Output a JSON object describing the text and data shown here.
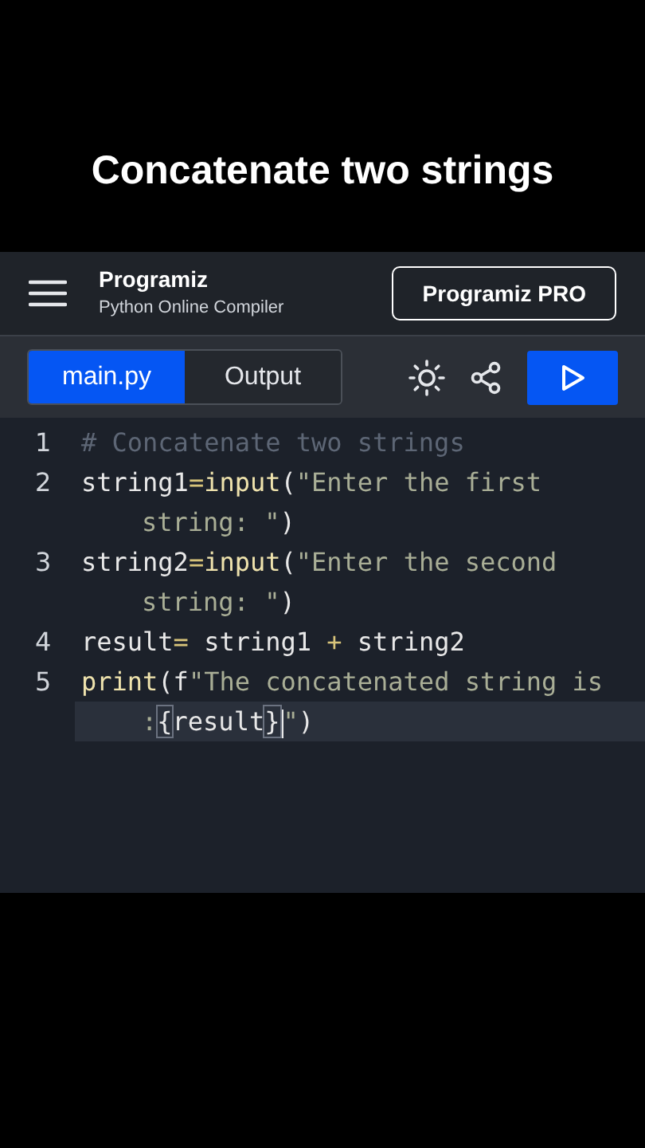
{
  "caption": "Concatenate two strings",
  "header": {
    "logo": "Programiz",
    "subtitle": "Python Online Compiler",
    "pro_button": "Programiz PRO"
  },
  "tabs": [
    {
      "label": "main.py",
      "selected": true
    },
    {
      "label": "Output",
      "selected": false
    }
  ],
  "code": [
    {
      "number": "1",
      "tokens": [
        {
          "kind": "comment",
          "text": "# Concatenate two strings"
        }
      ]
    },
    {
      "number": "2",
      "tokens": [
        {
          "kind": "plain",
          "text": "string1"
        },
        {
          "kind": "operator",
          "text": "="
        },
        {
          "kind": "function",
          "text": "input"
        },
        {
          "kind": "plain",
          "text": "("
        },
        {
          "kind": "string",
          "text": "\"Enter the first"
        }
      ],
      "continuation": [
        {
          "kind": "string",
          "text": "string: \""
        },
        {
          "kind": "plain",
          "text": ")"
        }
      ]
    },
    {
      "number": "3",
      "tokens": [
        {
          "kind": "plain",
          "text": "string2"
        },
        {
          "kind": "operator",
          "text": "="
        },
        {
          "kind": "function",
          "text": "input"
        },
        {
          "kind": "plain",
          "text": "("
        },
        {
          "kind": "string",
          "text": "\"Enter the second"
        }
      ],
      "continuation": [
        {
          "kind": "string",
          "text": "string: \""
        },
        {
          "kind": "plain",
          "text": ")"
        }
      ]
    },
    {
      "number": "4",
      "tokens": [
        {
          "kind": "plain",
          "text": "result"
        },
        {
          "kind": "operator",
          "text": "="
        },
        {
          "kind": "plain",
          "text": " string1 "
        },
        {
          "kind": "operator",
          "text": "+"
        },
        {
          "kind": "plain",
          "text": " string2"
        }
      ]
    },
    {
      "number": "5",
      "active": true,
      "tokens": [
        {
          "kind": "function",
          "text": "print"
        },
        {
          "kind": "plain",
          "text": "(f"
        },
        {
          "kind": "string",
          "text": "\"The concatenated string is"
        }
      ],
      "continuation": [
        {
          "kind": "string",
          "text": ":"
        },
        {
          "kind": "bracket",
          "text": "{"
        },
        {
          "kind": "plain",
          "text": "result"
        },
        {
          "kind": "bracket",
          "text": "}"
        },
        {
          "kind": "cursor"
        },
        {
          "kind": "string",
          "text": "\""
        },
        {
          "kind": "plain",
          "text": ")"
        }
      ]
    }
  ]
}
